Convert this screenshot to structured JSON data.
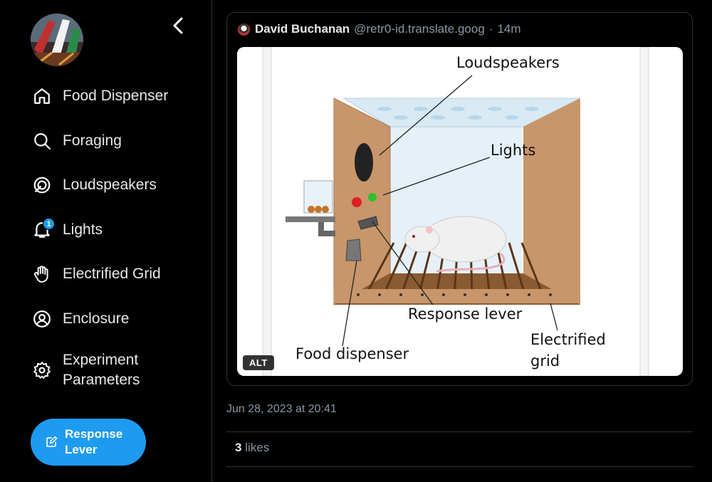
{
  "sidebar": {
    "back_icon": "chevron-left-icon",
    "items": [
      {
        "label": "Food Dispenser",
        "icon": "home-icon"
      },
      {
        "label": "Foraging",
        "icon": "search-icon"
      },
      {
        "label": "Loudspeakers",
        "icon": "spaces-icon"
      },
      {
        "label": "Lights",
        "icon": "bell-icon",
        "badge": "1"
      },
      {
        "label": "Electrified Grid",
        "icon": "hand-icon"
      },
      {
        "label": "Enclosure",
        "icon": "profile-icon"
      },
      {
        "label": "Experiment Parameters",
        "label_line1": "Experiment",
        "label_line2": "Parameters",
        "icon": "gear-icon"
      }
    ],
    "cta": {
      "line1": "Response",
      "line2": "Lever",
      "icon": "compose-icon",
      "color": "#1d9bf0"
    }
  },
  "post": {
    "author_name": "David Buchanan",
    "author_handle": "@retr0-id.translate.goog",
    "separator": "·",
    "age": "14m",
    "alt_label": "ALT",
    "diagram_labels": {
      "loudspeakers": "Loudspeakers",
      "lights": "Lights",
      "response_lever": "Response lever",
      "food_dispenser": "Food dispenser",
      "grid_line1": "Electrified",
      "grid_line2": "grid"
    },
    "timestamp": "Jun 28, 2023 at 20:41",
    "likes_count": "3",
    "likes_label": "likes"
  },
  "colors": {
    "background": "#000000",
    "accent": "#1d9bf0",
    "border": "#2f3336",
    "muted_text": "#8b98a5"
  }
}
